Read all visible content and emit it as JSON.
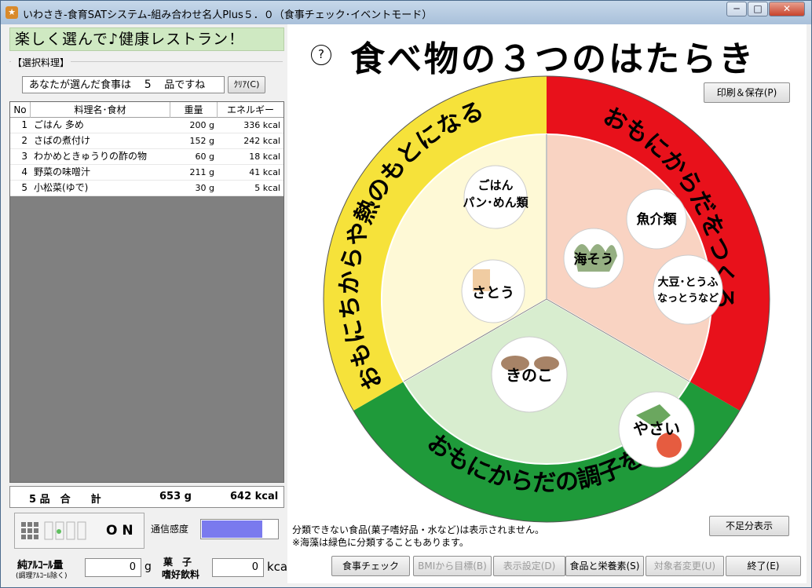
{
  "window": {
    "title": "いわさき-食育SATシステム-組み合わせ名人Plus５．０（食事チェック･イベントモード）",
    "minimize": "─",
    "maximize": "□",
    "close": "✕"
  },
  "left": {
    "banner": "楽しく選んで♪健康レストラン！",
    "group_label": "【選択料理】",
    "selection_prefix": "あなたが選んだ食事は",
    "selection_count": "5",
    "selection_suffix": "品ですね",
    "clear_button": "ｸﾘｱ(C)",
    "table": {
      "headers": [
        "No",
        "料理名･食材",
        "重量",
        "エネルギー"
      ],
      "rows": [
        {
          "no": "1",
          "name": "ごはん 多め",
          "weight": "200 g",
          "energy": "336 kcal"
        },
        {
          "no": "2",
          "name": "さばの煮付け",
          "weight": "152 g",
          "energy": "242 kcal"
        },
        {
          "no": "3",
          "name": "わかめときゅうりの酢の物",
          "weight": "60 g",
          "energy": "18 kcal"
        },
        {
          "no": "4",
          "name": "野菜の味噌汁",
          "weight": "211 g",
          "energy": "41 kcal"
        },
        {
          "no": "5",
          "name": "小松菜(ゆで)",
          "weight": "30 g",
          "energy": "5 kcal"
        }
      ]
    },
    "total": {
      "count": "5 品　合　　計",
      "weight": "653 g",
      "energy": "642 kcal"
    },
    "sensor_status": "O N",
    "comm_label": "通信感度",
    "comm_level": 0.8,
    "alcohol_label": "純ｱﾙｺｰﾙ量",
    "alcohol_sub": "(調理ｱﾙｺｰﾙ除く)",
    "alcohol_value": "0",
    "alcohol_unit": "g",
    "snack_label1": "菓　子",
    "snack_label2": "嗜好飲料",
    "snack_value": "0",
    "snack_unit": "kcal"
  },
  "right": {
    "help": "?",
    "headline": "食べ物の３つのはたらき",
    "print_button": "印刷＆保存(P)",
    "shortage_button": "不足分表示",
    "yellow_label": "おもにちからや熱のもとになる",
    "red_label": "おもにからだをつくる",
    "green_label": "おもにからだの調子をよくする",
    "foods": {
      "rice": [
        "ごはん",
        "パン･めん類"
      ],
      "sugar": "さとう",
      "fish": "魚介類",
      "seaweed": "海そう",
      "soy": [
        "大豆･とうふ",
        "なっとうなど"
      ],
      "mushroom": "きのこ",
      "vegetable": "やさい"
    },
    "note1": "分類できない食品(菓子嗜好品・水など)は表示されません。",
    "note2": "※海藻は緑色に分類することもあります。"
  },
  "buttons": {
    "meal_check": "食事チェック",
    "bmi_goal": "BMIから目標(B)",
    "display_settings": "表示設定(D)",
    "food_nutrients": "食品と栄養素(S)",
    "change_target": "対象者変更(U)",
    "exit": "終了(E)"
  },
  "colors": {
    "yellow": "#f6e23a",
    "red": "#e8111b",
    "green": "#1f9a3a",
    "yellow_fill": "#fef9d6",
    "red_fill": "#f9d3c2",
    "green_fill": "#d8edcf"
  }
}
